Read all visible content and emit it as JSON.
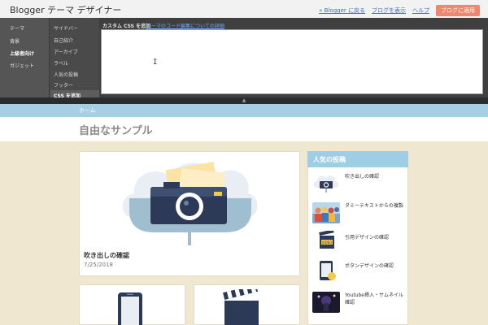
{
  "designer": {
    "title": "Blogger テーマ デザイナー",
    "links": [
      "« Blogger に戻る",
      "ブログを表示",
      "ヘルプ"
    ],
    "apply_label": "ブログに適用",
    "nav": [
      "テーマ",
      "背景",
      "上級者向け",
      "ガジェット"
    ],
    "active_nav": "上級者向け",
    "subnav": [
      "サイドバー",
      "自己紹介",
      "アーカイブ",
      "ラベル",
      "人気の投稿",
      "フッター",
      "CSS を追加"
    ],
    "active_subnav": "CSS を追加",
    "css_label": "カスタム CSS を追加",
    "css_help": "テーマのコード編集についての詳細",
    "css_value": ""
  },
  "blog": {
    "nav_home": "ホーム",
    "title": "自由なサンプル",
    "posts": [
      {
        "title": "吹き出しの確認",
        "date": "7/25/2018",
        "icon": "camera-cloud-image"
      },
      {
        "title": "",
        "date": "",
        "icon": "smartphone-image"
      },
      {
        "title": "",
        "date": "",
        "icon": "clapperboard-image"
      }
    ],
    "popular": {
      "title": "人気の投稿",
      "items": [
        {
          "title": "吹き出しの確認",
          "icon": "camera-cloud-thumb"
        },
        {
          "title": "ダミーテキストからの複製",
          "icon": "people-photo-thumb"
        },
        {
          "title": "引用デザインの確認",
          "icon": "video-thumb"
        },
        {
          "title": "ボタンデザインの確認",
          "icon": "smartphone-thumb"
        },
        {
          "title": "Youtube挿入・サムネイル確認",
          "icon": "concert-photo-thumb"
        }
      ]
    }
  },
  "colors": {
    "accent": "#f0866b",
    "nav_bar": "#a7cfe4",
    "widget_header": "#9fcde4",
    "page_bg": "#efe7cf"
  }
}
